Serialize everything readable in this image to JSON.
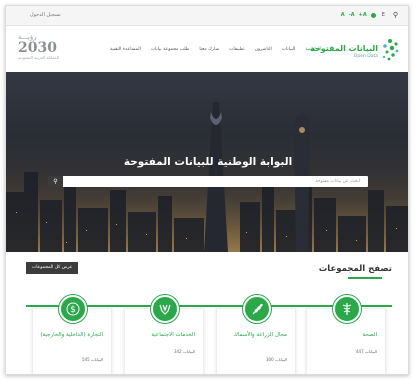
{
  "topbar": {
    "login_label": "تسجيل الدخول",
    "font_sizes": [
      "A",
      "A-",
      "A+"
    ],
    "lang_label": "E"
  },
  "header": {
    "brand_ar": "البيانات المفتوحة",
    "brand_en": "Open Data",
    "vision_ar": "رؤيـــة",
    "vision_num": "2030",
    "vision_sub": "المملكة العربية السعودية",
    "nav": [
      "الرئيسية",
      "البيانات",
      "الناشرون",
      "تطبيقات",
      "شارك معنا",
      "طلب مجموعة بيانات",
      "المساعدة التقنية"
    ]
  },
  "hero": {
    "title": "البوابة الوطنية للبيانات المفتوحة",
    "search_placeholder": "ابحث عن بيانات مفتوحة"
  },
  "groups": {
    "title": "تصفح المجموعات",
    "all_button": "عرض كل المجموعات",
    "cards": [
      {
        "name": "الصحة",
        "count": "البيانات 447"
      },
      {
        "name": "مجال الزراعة والأسماك",
        "count": "البيانات 300"
      },
      {
        "name": "الخدمات الاجتماعية",
        "count": "البيانات 342"
      },
      {
        "name": "التجارة (الداخلية والخارجية)",
        "count": "البيانات 545"
      }
    ]
  },
  "colors": {
    "accent": "#2aa84a",
    "dark": "#3b3b3b"
  }
}
